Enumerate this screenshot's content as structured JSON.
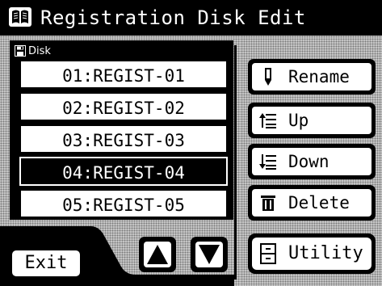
{
  "window": {
    "title": "Registration Disk Edit",
    "title_icon": "book-icon"
  },
  "disk_panel": {
    "label": "Disk",
    "icon": "floppy-disk-icon",
    "items": [
      {
        "label": "01:REGIST-01",
        "selected": false
      },
      {
        "label": "02:REGIST-02",
        "selected": false
      },
      {
        "label": "03:REGIST-03",
        "selected": false
      },
      {
        "label": "04:REGIST-04",
        "selected": true
      },
      {
        "label": "05:REGIST-05",
        "selected": false
      }
    ]
  },
  "scroll": {
    "up_icon": "triangle-up-icon",
    "down_icon": "triangle-down-icon"
  },
  "actions": {
    "rename": {
      "label": "Rename",
      "icon": "pen-icon"
    },
    "up": {
      "label": "Up",
      "icon": "list-up-icon"
    },
    "down": {
      "label": "Down",
      "icon": "list-down-icon"
    },
    "delete": {
      "label": "Delete",
      "icon": "trash-icon"
    },
    "utility": {
      "label": "Utility",
      "icon": "cabinet-icon"
    }
  },
  "footer": {
    "exit_label": "Exit"
  },
  "colors": {
    "foreground": "#000000",
    "background": "#ffffff",
    "pattern": "#c8c8c8"
  }
}
